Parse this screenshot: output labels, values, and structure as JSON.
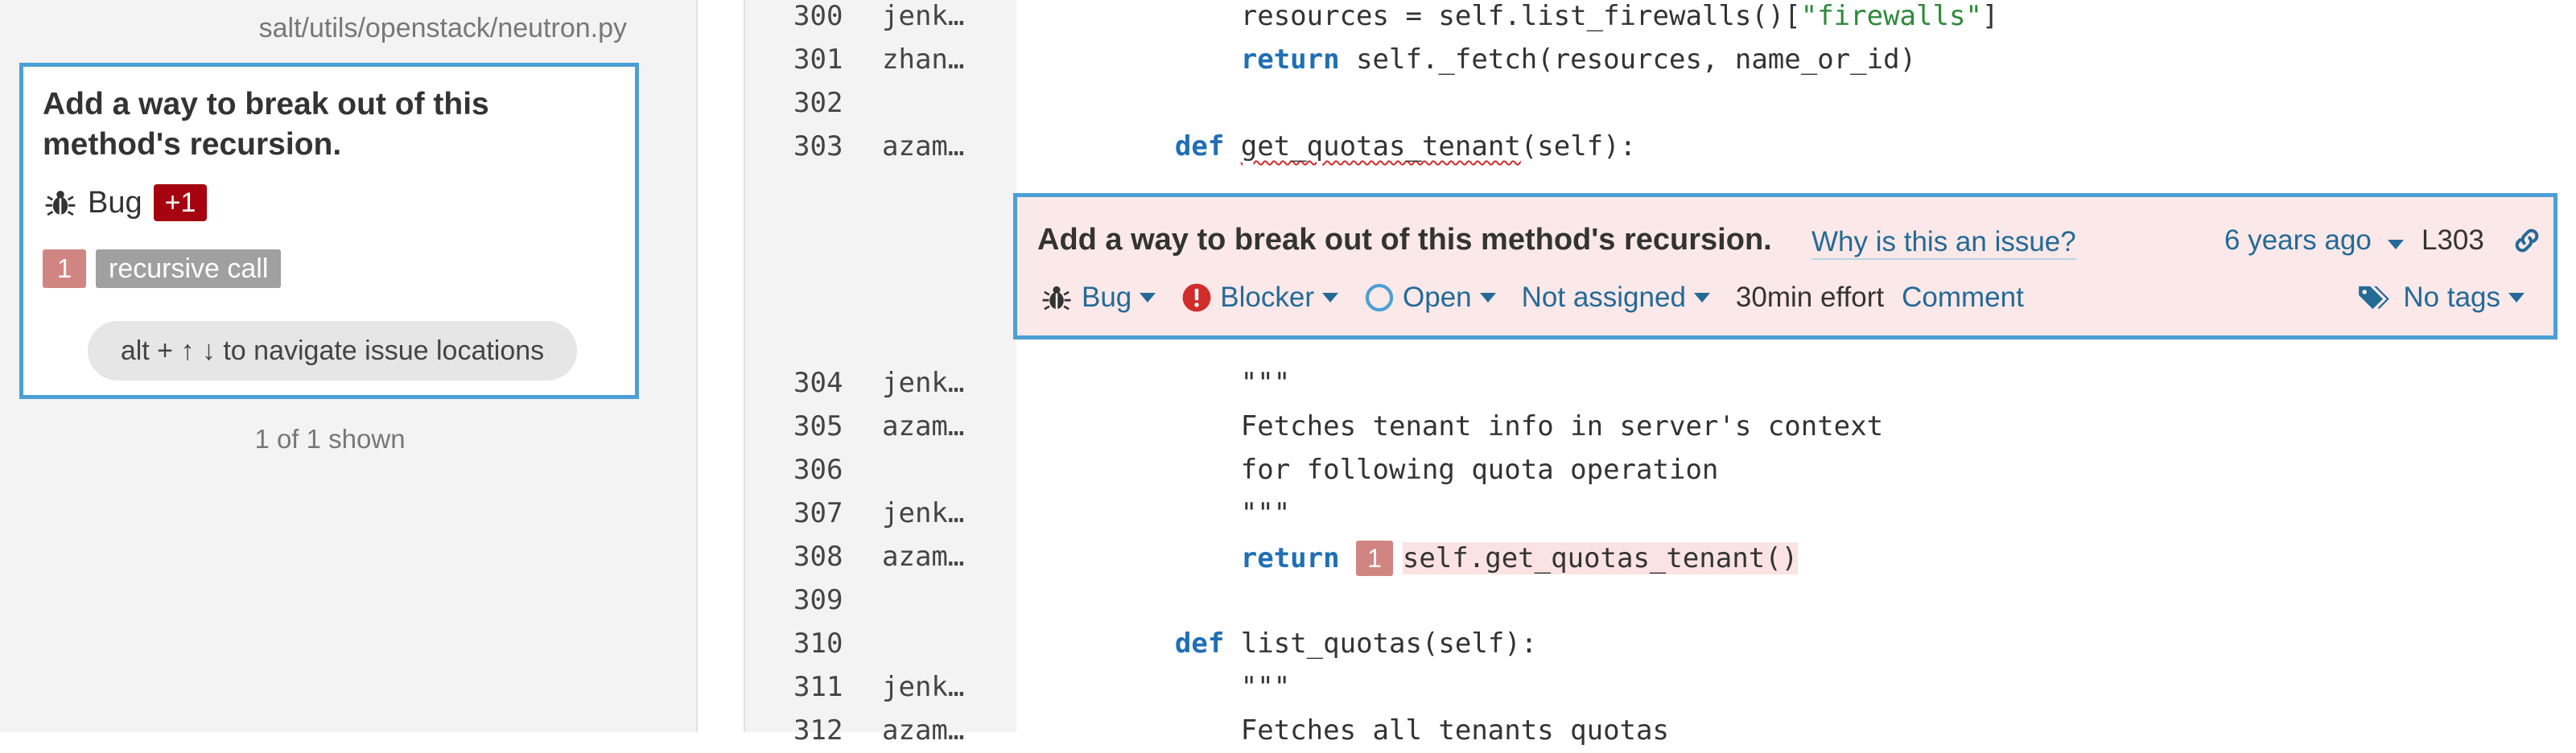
{
  "sidebar": {
    "file_path": "salt/utils/openstack/neutron.py",
    "issue": {
      "title": "Add a way to break out of this method's recursion.",
      "type": "Bug",
      "plus_badge": "+1",
      "location_number": "1",
      "location_message": "recursive call",
      "nav_hint": "alt + ↑ ↓ to navigate issue locations"
    },
    "shown_count": "1 of 1 shown"
  },
  "code_before": [
    {
      "num": "300",
      "author": "jenk…",
      "parts": [
        {
          "t": "        resources = self.list_firewalls()[",
          "c": ""
        },
        {
          "t": "\"firewalls\"",
          "c": "str"
        },
        {
          "t": "]",
          "c": ""
        }
      ]
    },
    {
      "num": "301",
      "author": "zhan…",
      "parts": [
        {
          "t": "        ",
          "c": ""
        },
        {
          "t": "return",
          "c": "kw"
        },
        {
          "t": " self._fetch(resources, name_or_id)",
          "c": ""
        }
      ]
    },
    {
      "num": "302",
      "author": "",
      "parts": []
    },
    {
      "num": "303",
      "author": "azam…",
      "parts": [
        {
          "t": "    ",
          "c": ""
        },
        {
          "t": "def",
          "c": "kw"
        },
        {
          "t": " ",
          "c": ""
        },
        {
          "t": "get_quotas_tenant",
          "c": "squiggle"
        },
        {
          "t": "(self):",
          "c": ""
        }
      ]
    }
  ],
  "code_after": [
    {
      "num": "304",
      "author": "jenk…",
      "parts": [
        {
          "t": "        \"\"\"",
          "c": ""
        }
      ]
    },
    {
      "num": "305",
      "author": "azam…",
      "parts": [
        {
          "t": "        Fetches tenant info in server's context",
          "c": ""
        }
      ]
    },
    {
      "num": "306",
      "author": "",
      "parts": [
        {
          "t": "        for following quota operation",
          "c": ""
        }
      ]
    },
    {
      "num": "307",
      "author": "jenk…",
      "parts": [
        {
          "t": "        \"\"\"",
          "c": ""
        }
      ]
    },
    {
      "num": "308",
      "author": "azam…",
      "parts": [
        {
          "t": "        ",
          "c": ""
        },
        {
          "t": "return",
          "c": "kw"
        },
        {
          "t": " ",
          "c": ""
        },
        {
          "t": "1",
          "c": "marker"
        },
        {
          "t": "self.get_quotas_tenant()",
          "c": "call-hl"
        }
      ]
    },
    {
      "num": "309",
      "author": "",
      "parts": []
    },
    {
      "num": "310",
      "author": "",
      "parts": [
        {
          "t": "    ",
          "c": ""
        },
        {
          "t": "def",
          "c": "kw"
        },
        {
          "t": " list_quotas(self):",
          "c": ""
        }
      ]
    },
    {
      "num": "311",
      "author": "jenk…",
      "parts": [
        {
          "t": "        \"\"\"",
          "c": ""
        }
      ]
    },
    {
      "num": "312",
      "author": "azam…",
      "parts": [
        {
          "t": "        Fetches all tenants quotas",
          "c": ""
        }
      ]
    }
  ],
  "issue_box": {
    "title": "Add a way to break out of this method's recursion.",
    "why_link": "Why is this an issue?",
    "date": "6 years ago",
    "line_ref": "L303",
    "type": "Bug",
    "severity": "Blocker",
    "status": "Open",
    "assignee": "Not assigned",
    "effort": "30min effort",
    "comment": "Comment",
    "tags": "No tags"
  },
  "colors": {
    "accent_blue": "#4b9fd5",
    "link_blue": "#236a97",
    "blocker_red": "#d02c2c",
    "badge_dark_red": "#a4030f",
    "issue_bg": "#fbe8e8"
  },
  "icons": [
    "bug-icon",
    "blocker-icon",
    "open-status-icon",
    "caret-down-icon",
    "permalink-icon",
    "tag-icon"
  ]
}
